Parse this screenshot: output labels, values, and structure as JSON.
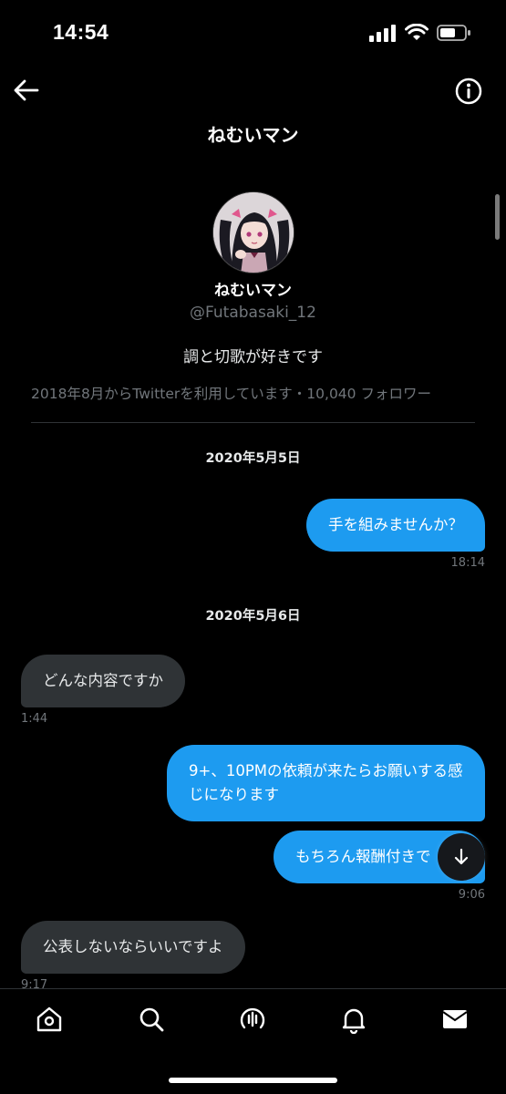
{
  "status_bar": {
    "time": "14:54"
  },
  "header": {
    "title": "ねむいマン"
  },
  "profile": {
    "name": "ねむいマン",
    "handle": "@Futabasaki_12",
    "bio": "調と切歌が好きです",
    "meta": "2018年8月からTwitterを利用しています・10,040 フォロワー"
  },
  "conversation": [
    {
      "type": "date",
      "text": "2020年5月5日"
    },
    {
      "type": "sent",
      "text": "手を組みませんか？",
      "time": "18:14"
    },
    {
      "type": "date",
      "text": "2020年5月6日"
    },
    {
      "type": "recv",
      "text": "どんな内容ですか",
      "time": "1:44"
    },
    {
      "type": "sent",
      "text": "9+、10PMの依頼が来たらお願いする感じになります"
    },
    {
      "type": "sent",
      "text": "もちろん報酬付きで",
      "time": "9:06"
    },
    {
      "type": "recv",
      "text": "公表しないならいいですよ",
      "time": "9:17"
    }
  ],
  "icons": {
    "back": "arrow-left-icon",
    "info": "info-icon",
    "scroll_down": "arrow-down-icon",
    "nav": [
      "home-icon",
      "search-icon",
      "spaces-icon",
      "bell-icon",
      "mail-icon"
    ]
  },
  "colors": {
    "accent": "#1d9bf0",
    "received_bubble": "#2f3336",
    "background": "#000000"
  }
}
